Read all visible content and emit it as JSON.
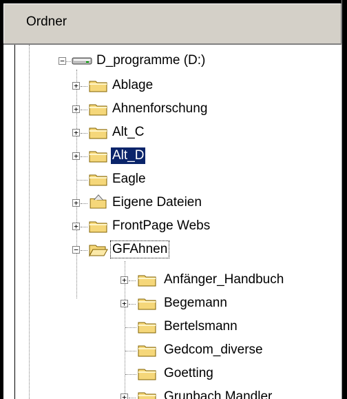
{
  "header": {
    "title": "Ordner"
  },
  "drive": {
    "label": "D_programme (D:)",
    "icon": "drive-icon"
  },
  "items": [
    {
      "label": "Ablage",
      "icon": "folder-icon",
      "expandable": true
    },
    {
      "label": "Ahnenforschung",
      "icon": "folder-icon",
      "expandable": true
    },
    {
      "label": "Alt_C",
      "icon": "folder-icon",
      "expandable": true
    },
    {
      "label": "Alt_D",
      "icon": "folder-icon",
      "expandable": true,
      "selected": true
    },
    {
      "label": "Eagle",
      "icon": "folder-icon",
      "expandable": false
    },
    {
      "label": "Eigene Dateien",
      "icon": "my-documents-folder-icon",
      "expandable": true
    },
    {
      "label": "FrontPage Webs",
      "icon": "folder-icon",
      "expandable": true
    },
    {
      "label": "GFAhnen",
      "icon": "open-folder-icon",
      "expandable": true,
      "expanded": true,
      "focused": true
    }
  ],
  "subitems": [
    {
      "label": "Anfänger_Handbuch",
      "icon": "folder-icon",
      "expandable": true
    },
    {
      "label": "Begemann",
      "icon": "folder-icon",
      "expandable": true
    },
    {
      "label": "Bertelsmann",
      "icon": "folder-icon",
      "expandable": false
    },
    {
      "label": "Gedcom_diverse",
      "icon": "folder-icon",
      "expandable": false
    },
    {
      "label": "Goetting",
      "icon": "folder-icon",
      "expandable": false
    },
    {
      "label": "Grunbach Mandler",
      "icon": "folder-icon",
      "expandable": true
    }
  ],
  "colors": {
    "selection": "#0a246a",
    "header_bg": "#d4d0c8",
    "folder": "#f5d77a"
  }
}
